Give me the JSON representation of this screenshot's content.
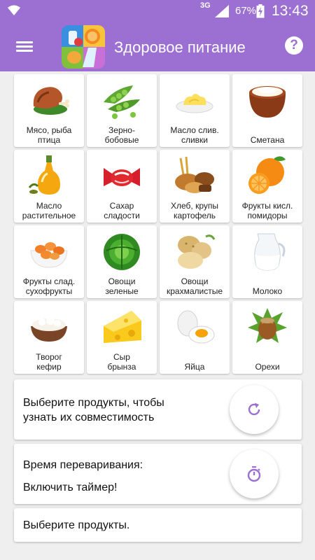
{
  "status_bar": {
    "network": "3G",
    "battery": "67%",
    "time": "13:43"
  },
  "app_bar": {
    "title": "Здоровое питание",
    "help_label": "?"
  },
  "tiles": [
    {
      "label": "Мясо, рыба\nптица",
      "icon": "meat-icon"
    },
    {
      "label": "Зерно-\nбобовые",
      "icon": "peas-icon"
    },
    {
      "label": "Масло слив.\nсливки",
      "icon": "butter-icon"
    },
    {
      "label": "Сметана",
      "icon": "sour-cream-icon"
    },
    {
      "label": "Масло\nрастительное",
      "icon": "oil-bottle-icon"
    },
    {
      "label": "Сахар\nсладости",
      "icon": "candy-icon"
    },
    {
      "label": "Хлеб, крупы\nкартофель",
      "icon": "bread-icon"
    },
    {
      "label": "Фрукты кисл.\nпомидоры",
      "icon": "orange-icon"
    },
    {
      "label": "Фрукты слад.\nсухофрукты",
      "icon": "dried-fruit-icon"
    },
    {
      "label": "Овощи\nзеленые",
      "icon": "cabbage-icon"
    },
    {
      "label": "Овощи\nкрахмалистые",
      "icon": "potato-icon"
    },
    {
      "label": "Молоко",
      "icon": "milk-jug-icon"
    },
    {
      "label": "Творог\nкефир",
      "icon": "cottage-cheese-icon"
    },
    {
      "label": "Сыр\nбрынза",
      "icon": "cheese-icon"
    },
    {
      "label": "Яйца",
      "icon": "egg-icon"
    },
    {
      "label": "Орехи",
      "icon": "hazelnut-icon"
    }
  ],
  "compat_card": {
    "text": "Выберите продукты, чтобы\nузнать их совместимость",
    "button_icon": "refresh-icon"
  },
  "digest_card": {
    "title": "Время переваривания:",
    "timer_label": "Включить таймер!",
    "button_icon": "stopwatch-icon"
  },
  "select_card": {
    "text": "Выберите продукты."
  },
  "colors": {
    "accent": "#9c6fd2",
    "background": "#efefef",
    "card": "#ffffff"
  }
}
